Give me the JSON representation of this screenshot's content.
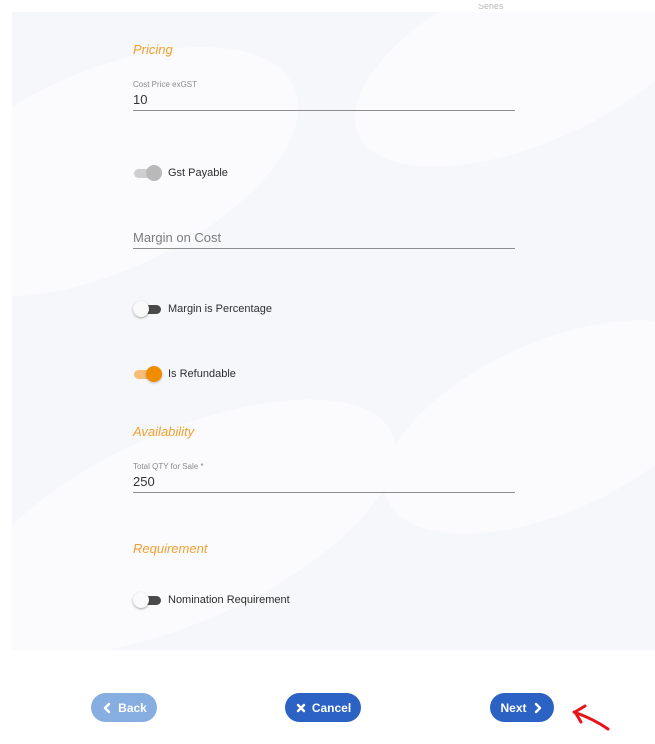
{
  "header": {
    "cut_text": "Series"
  },
  "pricing": {
    "title": "Pricing",
    "cost_price": {
      "label": "Cost Price exGST",
      "value": "10"
    },
    "gst_payable": {
      "label": "Gst Payable",
      "state": "on-disabled"
    },
    "margin_on_cost": {
      "placeholder": "Margin on Cost",
      "value": ""
    },
    "margin_is_percentage": {
      "label": "Margin is Percentage",
      "state": "off"
    },
    "is_refundable": {
      "label": "Is Refundable",
      "state": "on"
    }
  },
  "availability": {
    "title": "Availability",
    "total_qty": {
      "label": "Total QTY for Sale *",
      "value": "250"
    }
  },
  "requirement": {
    "title": "Requirement",
    "nomination": {
      "label": "Nomination Requirement",
      "state": "off"
    }
  },
  "actions": {
    "back_label": "Back",
    "cancel_label": "Cancel",
    "next_label": "Next"
  },
  "colors": {
    "accent_orange": "#f0a030",
    "toggle_on": "#f08c00",
    "primary_blue": "#2b62c4",
    "disabled_blue": "#87aee0",
    "annotation_red": "#e8141a"
  },
  "icons": {
    "back": "chevron-left-icon",
    "cancel": "close-icon",
    "next": "chevron-right-icon",
    "annotation": "red-arrow-icon"
  }
}
